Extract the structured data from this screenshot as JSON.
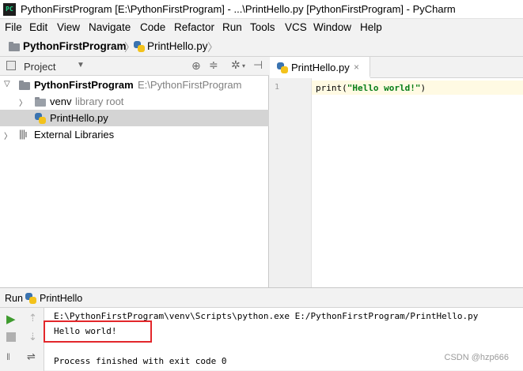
{
  "window": {
    "app_icon_text": "PC",
    "title": "PythonFirstProgram [E:\\PythonFirstProgram] - ...\\PrintHello.py [PythonFirstProgram] - PyCharm"
  },
  "menu": [
    "File",
    "Edit",
    "View",
    "Navigate",
    "Code",
    "Refactor",
    "Run",
    "Tools",
    "VCS",
    "Window",
    "Help"
  ],
  "breadcrumb": {
    "project": "PythonFirstProgram",
    "file": "PrintHello.py"
  },
  "project_panel": {
    "title": "Project",
    "tree": {
      "root_name": "PythonFirstProgram",
      "root_path": "E:\\PythonFirstProgram",
      "venv_name": "venv",
      "venv_hint": "library root",
      "file_name": "PrintHello.py",
      "external": "External Libraries"
    }
  },
  "editor": {
    "tab_label": "PrintHello.py",
    "line_number": "1",
    "code": {
      "func": "print(",
      "string": "\"Hello world!\"",
      "close": ")"
    }
  },
  "run_panel": {
    "label": "Run",
    "config_name": "PrintHello",
    "console": {
      "command": "E:\\PythonFirstProgram\\venv\\Scripts\\python.exe E:/PythonFirstProgram/PrintHello.py",
      "output": "Hello world!",
      "exit": "Process finished with exit code 0"
    }
  },
  "watermark": "CSDN @hzp666",
  "colors": {
    "highlight_box": "#e3272b",
    "run_green": "#3e9b2e",
    "code_string": "#067d17",
    "selected_row": "#d4d4d4",
    "current_line": "#fffae3"
  }
}
